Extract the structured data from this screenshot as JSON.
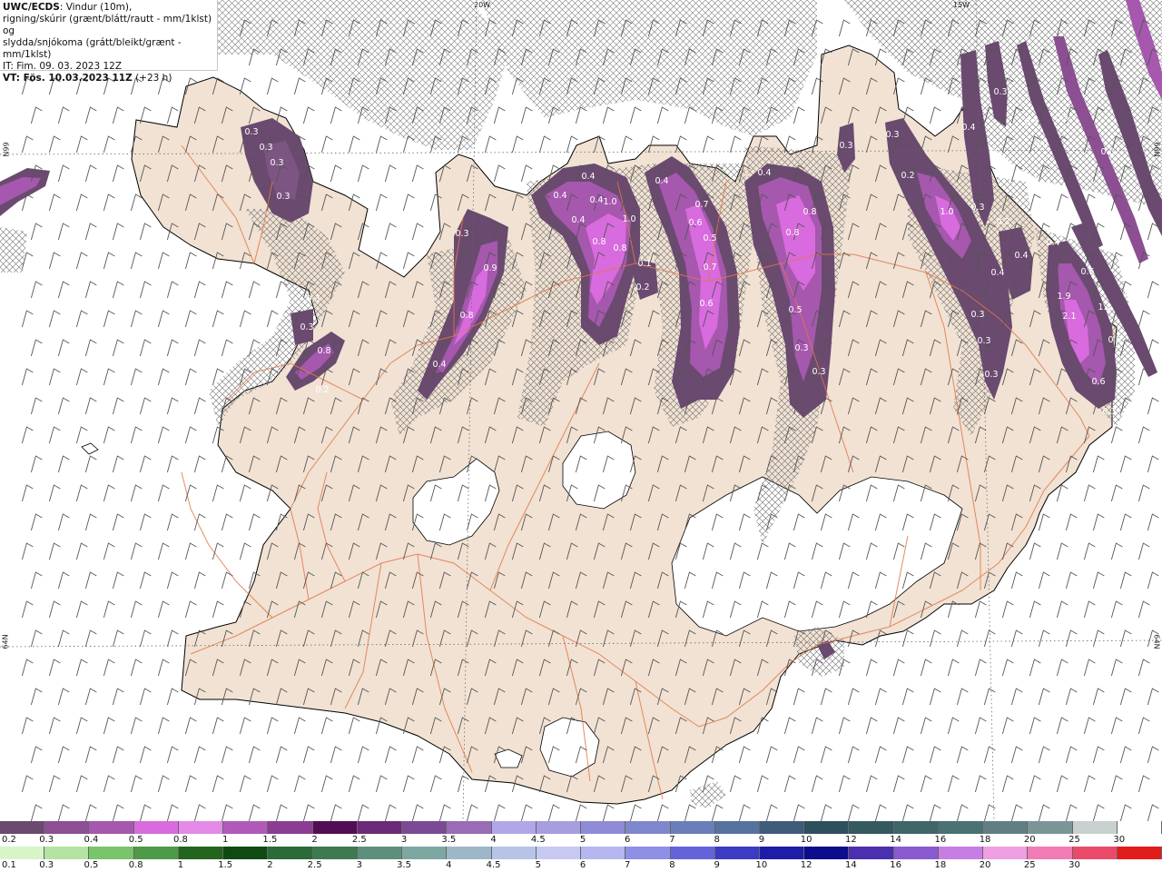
{
  "info": {
    "model": "UWC/ECDS",
    "line1": ": Vindur (10m),",
    "line2": "rigning/skúrir (grænt/blátt/rautt - mm/1klst) og",
    "line3": "slydda/snjókoma (grátt/bleikt/grænt - mm/1klst)",
    "it": "IT: Fim. 09. 03. 2023 12Z",
    "vt": "VT: Fös. 10.03.2023 11Z",
    "vt_lead": " (+23 h)"
  },
  "graticule": {
    "lon_20w": "20W",
    "lon_15w": "15W",
    "lat_66n_left": "66N",
    "lat_66n_right": "66N",
    "lat_64n_left": "64N",
    "lat_64n_right": "64N"
  },
  "precip_values": [
    "0.3",
    "0.3",
    "0.3",
    "0.3",
    "0.3",
    "0.3",
    "0.8",
    "0.2",
    "0.3",
    "0.9",
    "0.8",
    "0.4",
    "0.4",
    "0.4",
    "0.4",
    "0.4",
    "1.0",
    "1.0",
    "0.8",
    "0.8",
    "0.1",
    "0.2",
    "0.4",
    "0.6",
    "0.7",
    "0.5",
    "0.7",
    "0.6",
    "0.4",
    "0.8",
    "0.8",
    "0.5",
    "0.3",
    "0.3",
    "0.3",
    "0.3",
    "0.2",
    "1.0",
    "0.3",
    "0.4",
    "0.3",
    "0.4",
    "0.4",
    "0.3",
    "0.3",
    "0.3",
    "0.6",
    "1.9",
    "2.1",
    "1.1",
    "0.9",
    "0.6",
    "0.3",
    "0.2",
    "0.5",
    "0.5",
    "0.3",
    "0.2",
    "0.5",
    "0.4",
    "0.3"
  ],
  "legend_top": {
    "colors": [
      "#6a4a6f",
      "#8c4f92",
      "#a558ad",
      "#d86bde",
      "#e38ae8",
      "#b05ab8",
      "#8a3d93",
      "#520e55",
      "#6b2a78",
      "#7b4a95",
      "#9a6cb5",
      "#b1a6e8",
      "#a79ee0",
      "#8f8bd6",
      "#7f87cc",
      "#6a7fb8",
      "#56729e",
      "#3f5c7a",
      "#2e4f5c",
      "#34595f",
      "#3e6668",
      "#4a7173",
      "#627e82",
      "#7b9597",
      "#c8d0d0",
      "#ffffff"
    ],
    "labels": [
      "0.2",
      "0.3",
      "0.4",
      "0.5",
      "0.8",
      "1",
      "1.5",
      "2",
      "2.5",
      "3",
      "3.5",
      "4",
      "4.5",
      "5",
      "6",
      "7",
      "8",
      "9",
      "10",
      "12",
      "14",
      "16",
      "18",
      "20",
      "25",
      "30"
    ]
  },
  "legend_bottom": {
    "colors": [
      "#d8f5c8",
      "#b4e2a2",
      "#7ac46c",
      "#4f9a47",
      "#23641e",
      "#0f4a12",
      "#2b6a39",
      "#3d7a52",
      "#5f8f7c",
      "#7da8a2",
      "#9db7c9",
      "#b7c4e6",
      "#c8c9f2",
      "#b6b6f0",
      "#8f8fe6",
      "#6464d8",
      "#3b3bc4",
      "#1d1da8",
      "#0c0c8c",
      "#4a2fb0",
      "#8a5ad0",
      "#c77ee3",
      "#ee9ee3",
      "#f17bb4",
      "#ea4a6a",
      "#e21b1b"
    ],
    "labels": [
      "0.1",
      "0.3",
      "0.5",
      "0.8",
      "1",
      "1.5",
      "2",
      "2.5",
      "3",
      "3.5",
      "4",
      "4.5",
      "5",
      "6",
      "7",
      "8",
      "9",
      "10",
      "12",
      "14",
      "16",
      "18",
      "20",
      "25",
      "30",
      ""
    ]
  }
}
